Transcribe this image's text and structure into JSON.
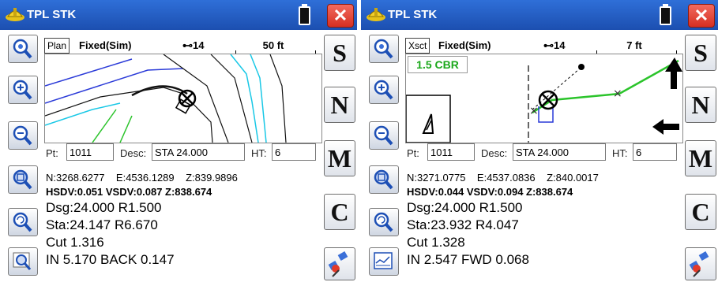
{
  "left": {
    "title": "TPL STK",
    "close_label": "✕",
    "view_tab": "Plan",
    "mode": "Fixed(Sim)",
    "satellites": "14",
    "scale": "50 ft",
    "pt_label": "Pt:",
    "pt_value": "1011",
    "desc_label": "Desc:",
    "desc_value": "STA 24.000",
    "ht_label": "HT:",
    "ht_value": "6",
    "northing": "N:3268.6277",
    "easting": "E:4536.1289",
    "elevation": "Z:839.9896",
    "sdv_line": "HSDV:0.051 VSDV:0.087 Z:838.674",
    "dsg_line": "Dsg:24.000 R1.500",
    "sta_line": "Sta:24.147 R6.670",
    "cut_line": "Cut 1.316",
    "dir_line": "IN 5.170 BACK 0.147",
    "buttons": [
      "S",
      "N",
      "M",
      "C"
    ]
  },
  "right": {
    "title": "TPL STK",
    "close_label": "✕",
    "view_tab": "Xsct",
    "mode": "Fixed(Sim)",
    "satellites": "14",
    "scale": "7 ft",
    "cbr": "1.5 CBR",
    "pt_label": "Pt:",
    "pt_value": "1011",
    "desc_label": "Desc:",
    "desc_value": "STA 24.000",
    "ht_label": "HT:",
    "ht_value": "6",
    "northing": "N:3271.0775",
    "easting": "E:4537.0836",
    "elevation": "Z:840.0017",
    "sdv_line": "HSDV:0.044 VSDV:0.094 Z:838.674",
    "dsg_line": "Dsg:24.000 R1.500",
    "sta_line": "Sta:23.932 R4.047",
    "cut_line": "Cut 1.328",
    "dir_line": "IN 2.547 FWD 0.068",
    "buttons": [
      "S",
      "N",
      "M",
      "C"
    ]
  },
  "colors": {
    "titlebar": "#1f56bd",
    "close": "#e0392c",
    "cbr_green": "#1aa81a",
    "map_cyan": "#19c8e6",
    "map_blue": "#2a3ad8",
    "map_green": "#2bc42b"
  }
}
